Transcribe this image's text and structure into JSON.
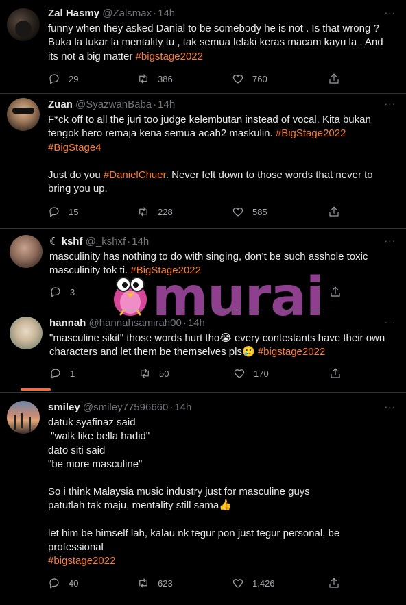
{
  "tweets": [
    {
      "name": "Zal Hasmy",
      "handle": "@Zalsmax",
      "time": "14h",
      "lines": [
        {
          "text": "funny when they asked Danial to be somebody he is not . Is that wrong ?"
        },
        {
          "text": "Buka la tukar la mentality tu , tak semua lelaki keras macam kayu la . And"
        },
        {
          "text": "its not a big matter ",
          "tag": "#bigstage2022"
        }
      ],
      "replies": "29",
      "retweets": "386",
      "likes": "760"
    },
    {
      "name": "Zuan",
      "handle": "@SyazwanBaba",
      "time": "14h",
      "lines": [
        {
          "text": "F*ck off to all the juri too judge kelembutan instead of vocal. Kita bukan"
        },
        {
          "text": "tengok hero remaja kena semua acah2 maskulin. ",
          "tag": "#BigStage2022"
        },
        {
          "text": "",
          "tag": "#BigStage4"
        },
        {
          "text": ""
        },
        {
          "text": "Just do you ",
          "tag": "#DanielChuer",
          "after": ". Never felt down to those words that never to"
        },
        {
          "text": "bring you up."
        }
      ],
      "replies": "15",
      "retweets": "228",
      "likes": "585"
    },
    {
      "name": "kshf",
      "name_prefix": "☾",
      "handle": "@_kshxf",
      "time": "14h",
      "lines": [
        {
          "text": "masculinity has nothing to do with singing, don’t be such asshole toxic"
        },
        {
          "text": "masculinity tok ti. ",
          "tag": "#BigStage2022"
        }
      ],
      "replies": "3",
      "retweets": "",
      "likes": ""
    },
    {
      "name": "hannah",
      "handle": "@hannahsamirah00",
      "time": "14h",
      "lines": [
        {
          "text": "\"masculine sikit\" those words hurt tho😭 every contestants have their own"
        },
        {
          "text": "characters and let them be themselves pls🥲 ",
          "tag": "#bigstage2022"
        }
      ],
      "replies": "1",
      "retweets": "50",
      "likes": "170"
    },
    {
      "name": "smiley",
      "handle": "@smiley77596660",
      "time": "14h",
      "lines": [
        {
          "text": "datuk syafinaz said"
        },
        {
          "text": " \"walk like bella hadid\""
        },
        {
          "text": "dato siti said"
        },
        {
          "text": "\"be more masculine\""
        },
        {
          "text": ""
        },
        {
          "text": "So i think Malaysia music industry just for masculine guys"
        },
        {
          "text": "patutlah tak maju, mentality still sama👍"
        },
        {
          "text": ""
        },
        {
          "text": "let him be himself lah, kalau nk tegur pon just tegur personal, be"
        },
        {
          "text": "professional"
        },
        {
          "text": "",
          "tag": "#bigstage2022"
        }
      ],
      "replies": "40",
      "retweets": "623",
      "likes": "1,426"
    }
  ],
  "watermark": {
    "text": "murai"
  },
  "colors": {
    "hashtag": "#ff7a2f",
    "watermark": "#8e3f8e",
    "muted": "#71767b"
  },
  "icons": [
    "reply-icon",
    "retweet-icon",
    "like-icon",
    "share-icon",
    "more-icon"
  ]
}
